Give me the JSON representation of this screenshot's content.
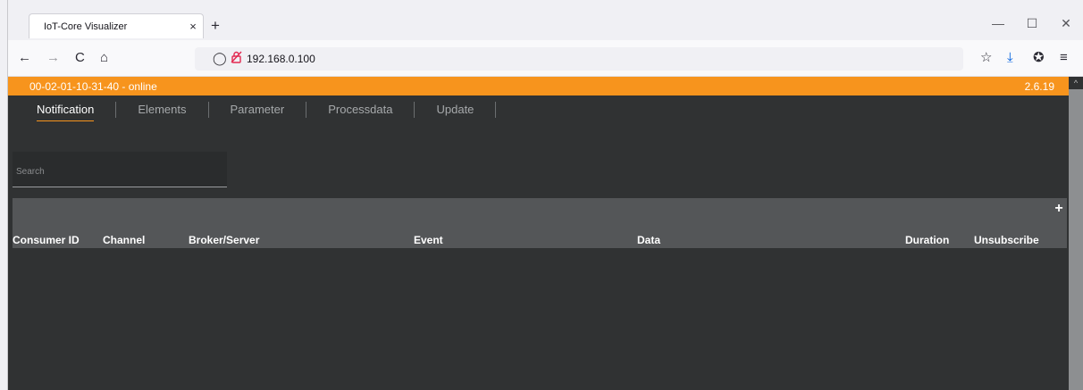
{
  "browser": {
    "tab_title": "IoT-Core Visualizer",
    "tab_close": "×",
    "new_tab": "+",
    "url": "192.168.0.100",
    "icons": {
      "back": "←",
      "forward": "→",
      "reload": "C",
      "home": "⌂",
      "shield": "◯",
      "lock": "🔒",
      "star": "☆",
      "download": "⤓",
      "extension": "✪",
      "menu": "≡",
      "minimize": "—",
      "maximize": "☐",
      "close": "✕"
    }
  },
  "statusbar": {
    "device": "00-02-01-10-31-40 - online",
    "version": "2.6.19",
    "color": "#f7941d"
  },
  "tabs": [
    {
      "label": "Notification",
      "active": true
    },
    {
      "label": "Elements",
      "active": false
    },
    {
      "label": "Parameter",
      "active": false
    },
    {
      "label": "Processdata",
      "active": false
    },
    {
      "label": "Update",
      "active": false
    }
  ],
  "search": {
    "placeholder": "Search"
  },
  "table": {
    "add_label": "+",
    "columns": [
      "Consumer ID",
      "Channel",
      "Broker/Server",
      "Event",
      "Data",
      "Duration",
      "Unsubscribe"
    ]
  }
}
